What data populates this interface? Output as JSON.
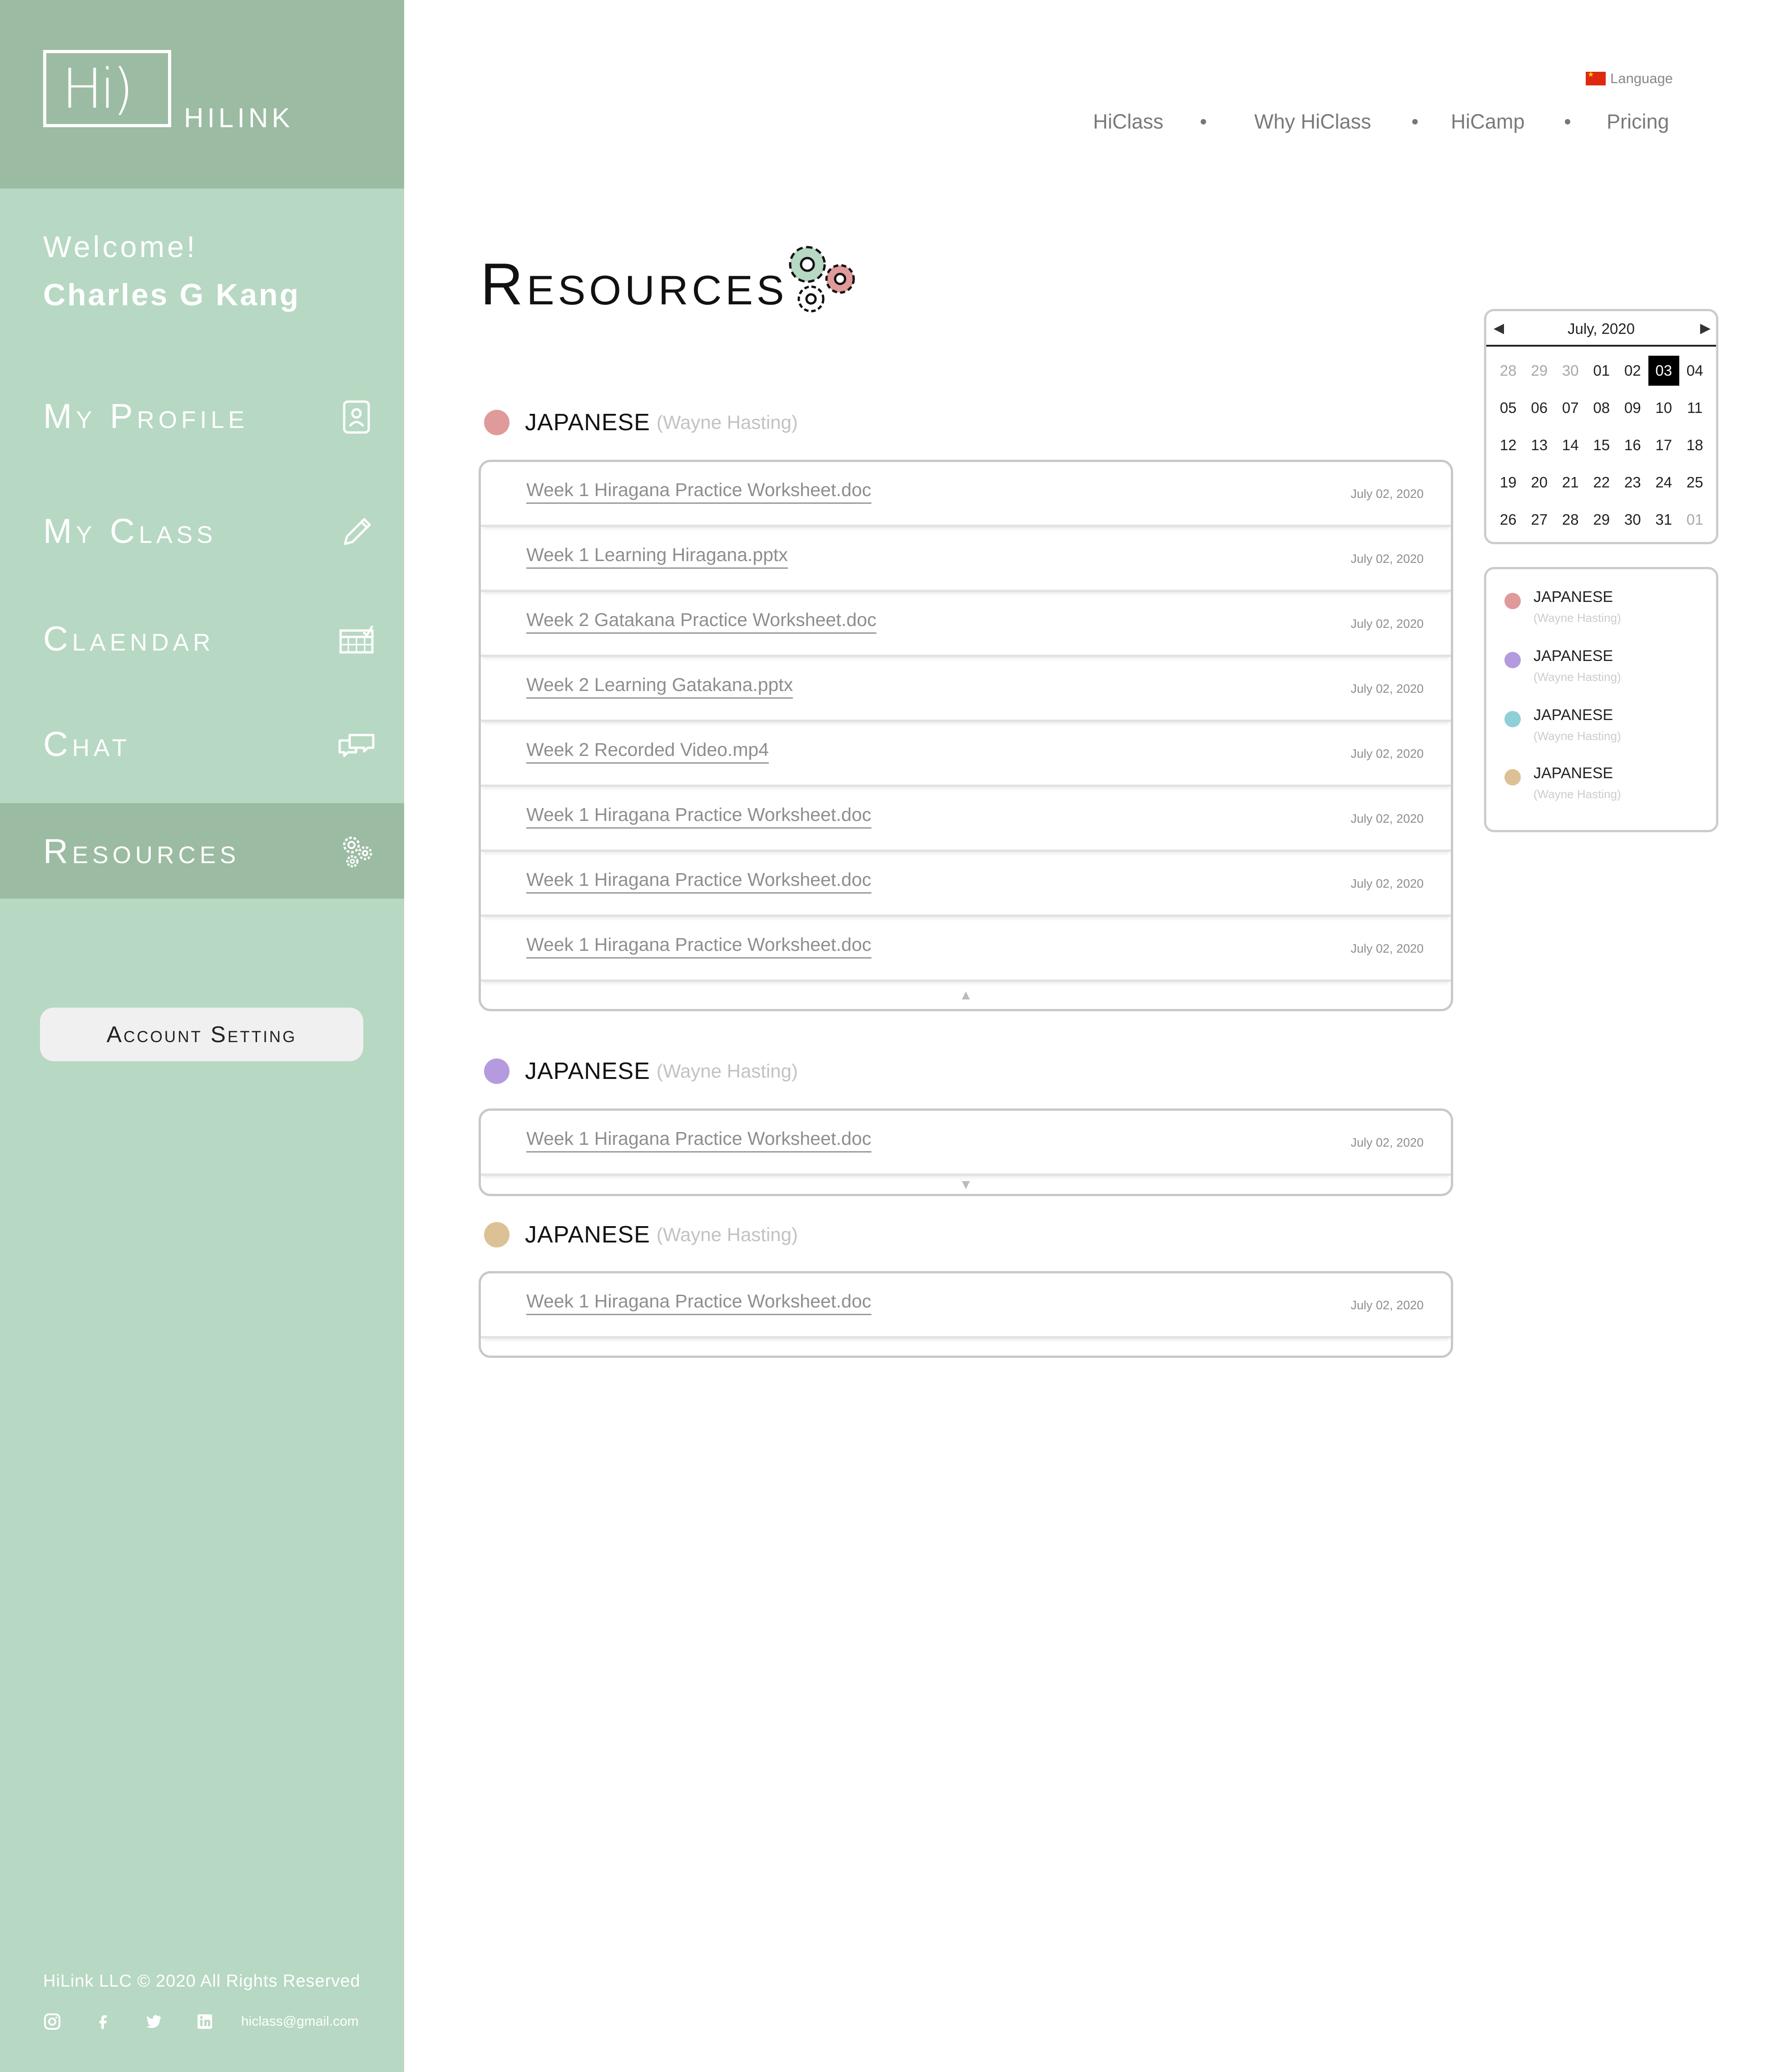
{
  "brand": {
    "logo_glyph": "Hi)",
    "name": "HILINK"
  },
  "sidebar": {
    "welcome": "Welcome!",
    "user_name": "Charles G Kang",
    "items": [
      {
        "label": "My Profile",
        "icon": "profile-icon",
        "active": false
      },
      {
        "label": "My Class",
        "icon": "pencil-icon",
        "active": false
      },
      {
        "label": "Claendar",
        "icon": "calendar-icon",
        "active": false
      },
      {
        "label": "Chat",
        "icon": "chat-icon",
        "active": false
      },
      {
        "label": "Resources",
        "icon": "gears-icon",
        "active": true
      }
    ],
    "account_setting": "Account Setting",
    "colors": {
      "background": "#b7d8c2",
      "header": "#9bbba2",
      "active": "#9bbba2"
    }
  },
  "footer": {
    "copyright": "HiLink LLC © 2020 All Rights Reserved",
    "social": [
      "instagram-icon",
      "facebook-icon",
      "twitter-icon",
      "linkedin-icon"
    ],
    "email": "hiclass@gmail.com"
  },
  "topnav": {
    "language": "Language",
    "links": [
      "HiClass",
      "Why HiClass",
      "HiCamp",
      "Pricing"
    ]
  },
  "page": {
    "title": "Resources"
  },
  "groups": [
    {
      "subject": "JAPANESE",
      "teacher": "(Wayne Hasting)",
      "color": "#e09a9a",
      "toggle": "▲",
      "files": [
        {
          "name": "Week 1 Hiragana Practice Worksheet.doc",
          "date": "July 02, 2020"
        },
        {
          "name": "Week 1 Learning Hiragana.pptx",
          "date": "July 02, 2020"
        },
        {
          "name": "Week 2 Gatakana Practice Worksheet.doc",
          "date": "July 02, 2020"
        },
        {
          "name": "Week 2 Learning Gatakana.pptx",
          "date": "July 02, 2020"
        },
        {
          "name": "Week 2 Recorded Video.mp4",
          "date": "July 02, 2020"
        },
        {
          "name": "Week 1 Hiragana Practice Worksheet.doc",
          "date": "July 02, 2020"
        },
        {
          "name": "Week 1 Hiragana Practice Worksheet.doc",
          "date": "July 02, 2020"
        },
        {
          "name": "Week 1 Hiragana Practice Worksheet.doc",
          "date": "July 02, 2020"
        }
      ]
    },
    {
      "subject": "JAPANESE",
      "teacher": "(Wayne Hasting)",
      "color": "#b49ade",
      "toggle": "▼",
      "files": [
        {
          "name": "Week 1 Hiragana Practice Worksheet.doc",
          "date": "July 02, 2020"
        }
      ]
    },
    {
      "subject": "JAPANESE",
      "teacher": "(Wayne Hasting)",
      "color": "#dcc196",
      "toggle": "",
      "files": [
        {
          "name": "Week 1 Hiragana Practice Worksheet.doc",
          "date": "July 02, 2020"
        }
      ]
    }
  ],
  "calendar": {
    "title": "July, 2020",
    "prev": "◀",
    "next": "▶",
    "selected": "03",
    "weeks": [
      [
        {
          "d": "28",
          "m": true
        },
        {
          "d": "29",
          "m": true
        },
        {
          "d": "30",
          "m": true
        },
        {
          "d": "01"
        },
        {
          "d": "02"
        },
        {
          "d": "03",
          "s": true
        },
        {
          "d": "04"
        }
      ],
      [
        {
          "d": "05"
        },
        {
          "d": "06"
        },
        {
          "d": "07"
        },
        {
          "d": "08"
        },
        {
          "d": "09"
        },
        {
          "d": "10"
        },
        {
          "d": "11"
        }
      ],
      [
        {
          "d": "12"
        },
        {
          "d": "13"
        },
        {
          "d": "14"
        },
        {
          "d": "15"
        },
        {
          "d": "16"
        },
        {
          "d": "17"
        },
        {
          "d": "18"
        }
      ],
      [
        {
          "d": "19"
        },
        {
          "d": "20"
        },
        {
          "d": "21"
        },
        {
          "d": "22"
        },
        {
          "d": "23"
        },
        {
          "d": "24"
        },
        {
          "d": "25"
        }
      ],
      [
        {
          "d": "26"
        },
        {
          "d": "27"
        },
        {
          "d": "28"
        },
        {
          "d": "29"
        },
        {
          "d": "30"
        },
        {
          "d": "31"
        },
        {
          "d": "01",
          "m": true
        }
      ]
    ]
  },
  "legend": [
    {
      "subject": "JAPANESE",
      "teacher": "(Wayne Hasting)",
      "color": "#e09a9a"
    },
    {
      "subject": "JAPANESE",
      "teacher": "(Wayne Hasting)",
      "color": "#b49ade"
    },
    {
      "subject": "JAPANESE",
      "teacher": "(Wayne Hasting)",
      "color": "#8fd0d8"
    },
    {
      "subject": "JAPANESE",
      "teacher": "(Wayne Hasting)",
      "color": "#dcc196"
    }
  ]
}
